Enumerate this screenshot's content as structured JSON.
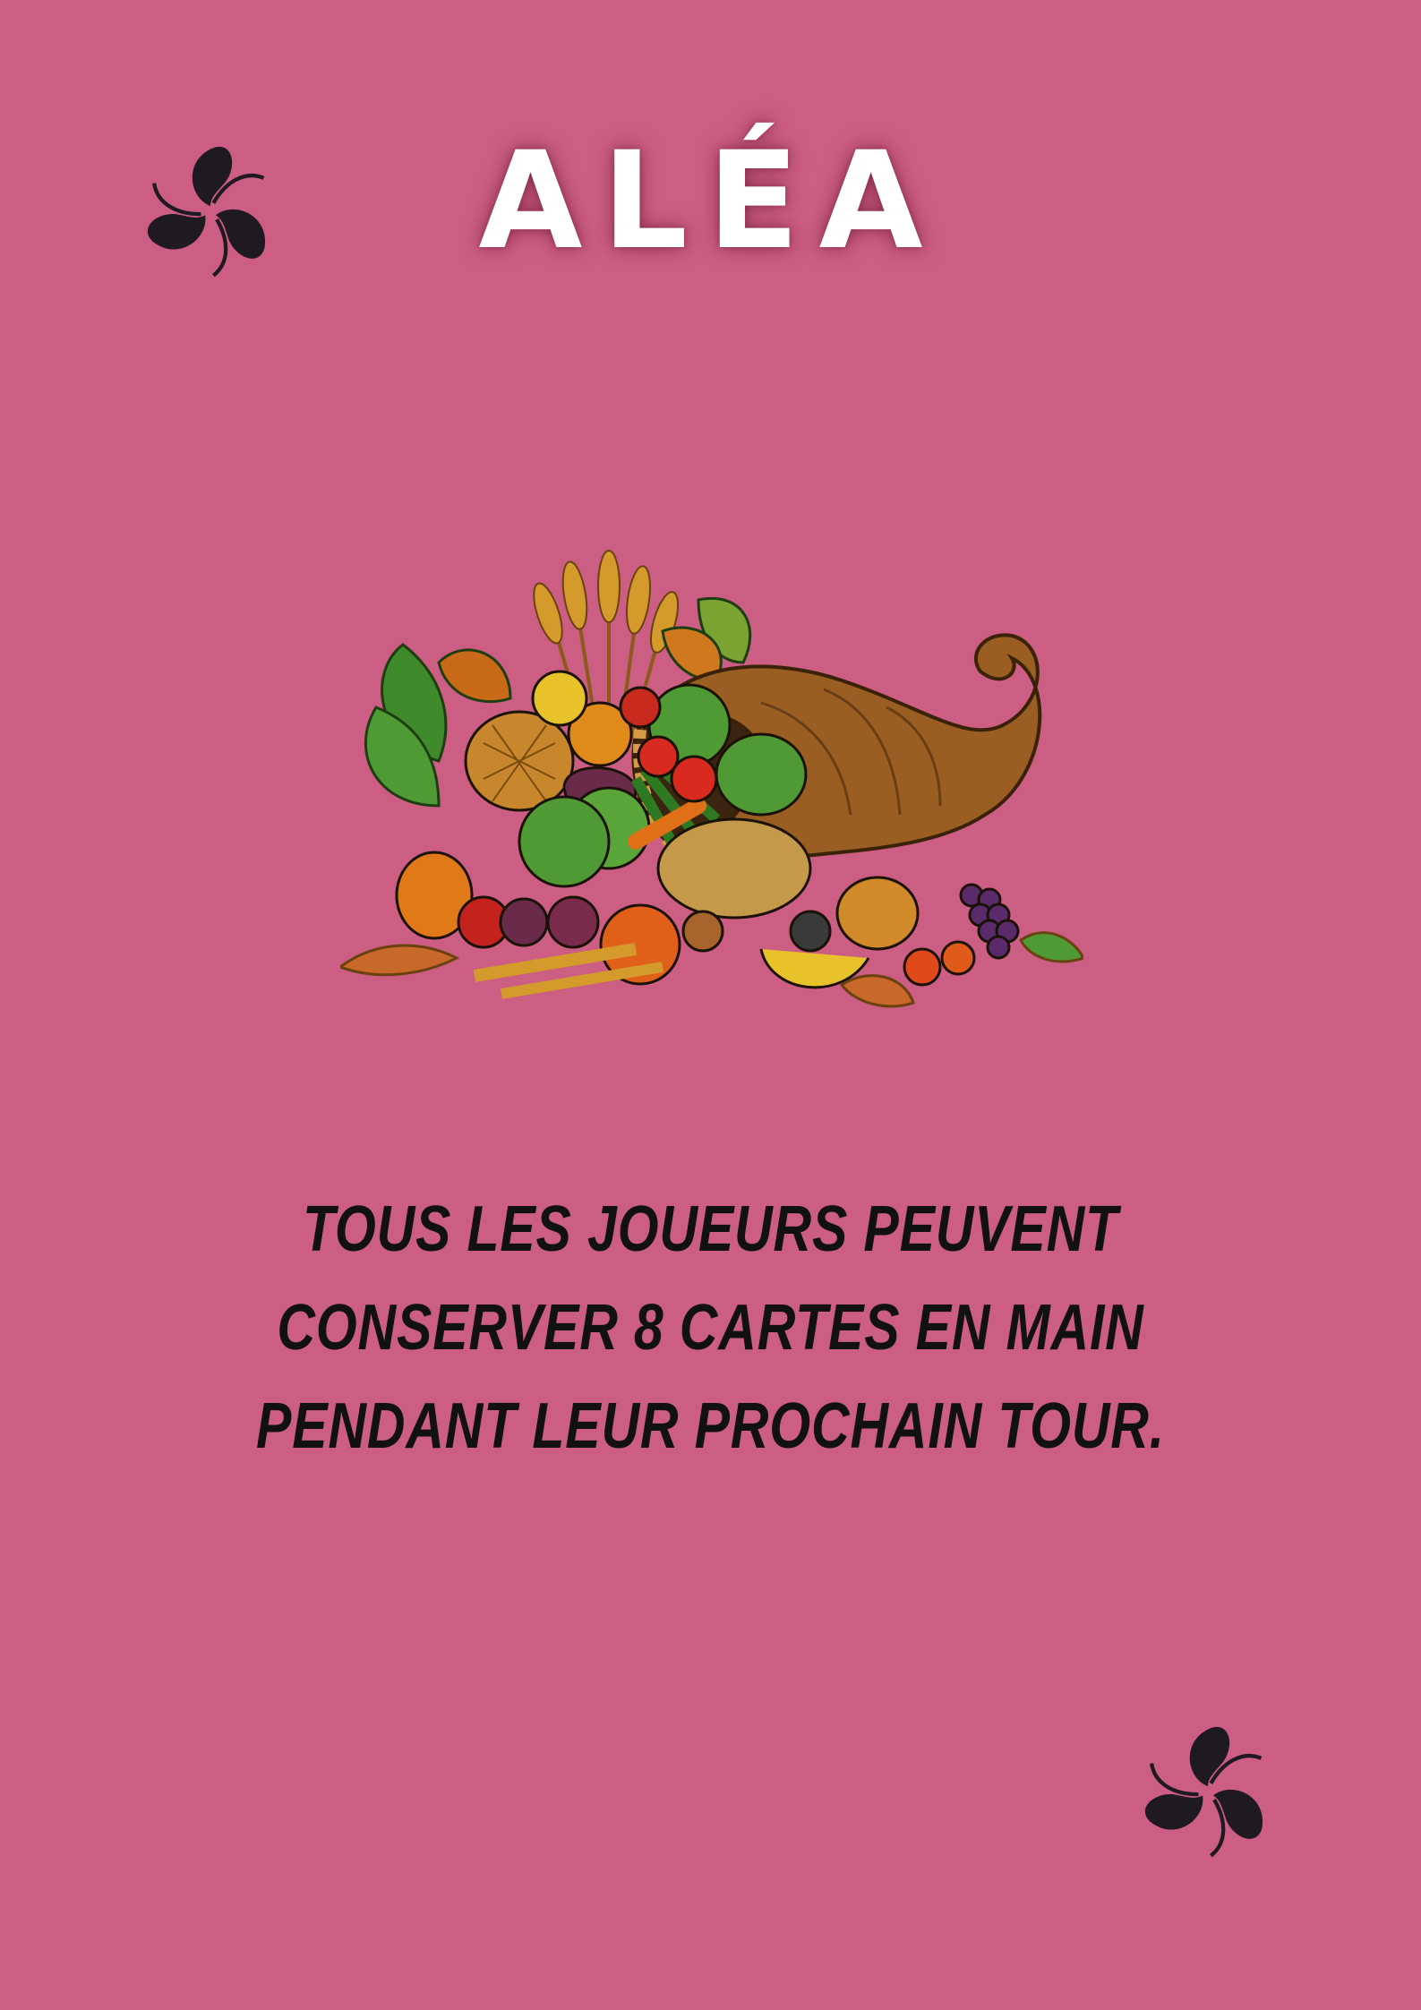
{
  "card": {
    "title": "ALÉA",
    "effect_text": "TOUS LES JOUEURS PEUVENT CONSERVER 8 CARTES EN MAIN PENDANT LEUR PROCHAIN TOUR.",
    "illustration": "cornucopia-illustration",
    "corner_icon": "swirl-leaf-icon",
    "colors": {
      "background": "#cb5e82",
      "title": "#ffffff",
      "text": "#111111",
      "icon": "#1f1a22"
    }
  }
}
